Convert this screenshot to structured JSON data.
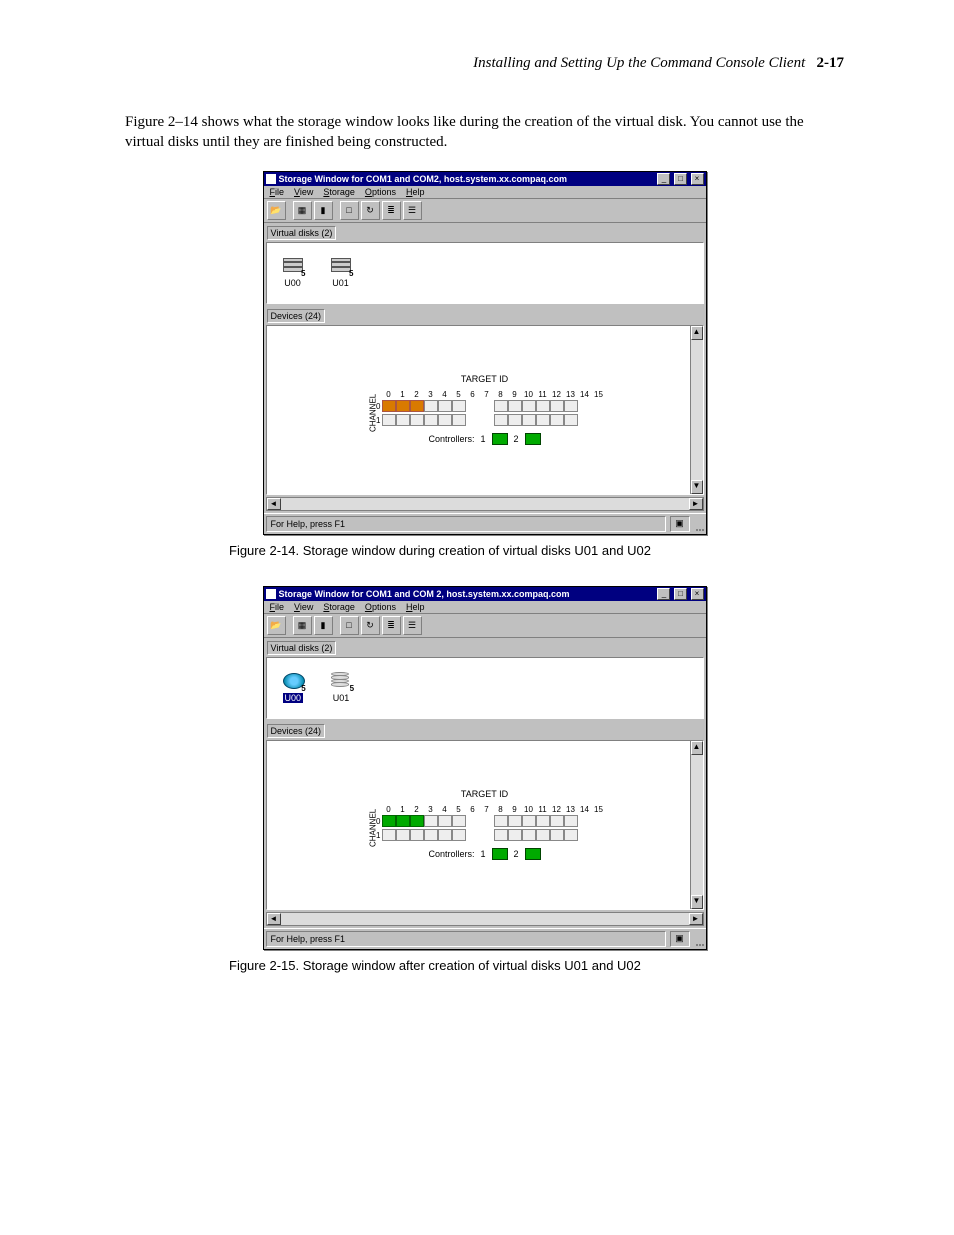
{
  "page": {
    "header_title": "Installing and Setting Up the Command Console Client",
    "header_page": "2-17",
    "intro": "Figure 2–14 shows what the storage window looks like during the creation of the virtual disk. You cannot use the virtual disks until they are finished being constructed."
  },
  "fig14": {
    "window_title": "Storage Window for COM1 and COM2, host.system.xx.compaq.com",
    "menus": {
      "file": "File",
      "view": "View",
      "storage": "Storage",
      "options": "Options",
      "help": "Help"
    },
    "vdisk_panel_label": "Virtual disks (2)",
    "vdisks": [
      {
        "name": "U00",
        "sub": "5",
        "state": "creating"
      },
      {
        "name": "U01",
        "sub": "5",
        "state": "creating"
      }
    ],
    "device_panel_label": "Devices (24)",
    "target_id_label": "TARGET ID",
    "channel_label": "CHANNEL",
    "target_ids": [
      "0",
      "1",
      "2",
      "3",
      "4",
      "5",
      "6",
      "7",
      "8",
      "9",
      "10",
      "11",
      "12",
      "13",
      "14",
      "15"
    ],
    "rows": [
      "0",
      "1"
    ],
    "row0_highlight_creating": [
      0,
      1,
      2
    ],
    "controllers_label": "Controllers:",
    "controllers": [
      "1",
      "2"
    ],
    "status": "For Help, press F1",
    "caption": "Figure 2-14.  Storage window during creation of virtual disks U01 and U02"
  },
  "fig15": {
    "window_title": "Storage Window for COM1 and COM 2, host.system.xx.compaq.com",
    "menus": {
      "file": "File",
      "view": "View",
      "storage": "Storage",
      "options": "Options",
      "help": "Help"
    },
    "vdisk_panel_label": "Virtual disks (2)",
    "vdisks": [
      {
        "name": "U00",
        "sub": "5",
        "state": "ready",
        "selected": true
      },
      {
        "name": "U01",
        "sub": "5",
        "state": "ready"
      }
    ],
    "device_panel_label": "Devices (24)",
    "target_id_label": "TARGET ID",
    "channel_label": "CHANNEL",
    "target_ids": [
      "0",
      "1",
      "2",
      "3",
      "4",
      "5",
      "6",
      "7",
      "8",
      "9",
      "10",
      "11",
      "12",
      "13",
      "14",
      "15"
    ],
    "rows": [
      "0",
      "1"
    ],
    "row0_highlight_ready": [
      0,
      1,
      2
    ],
    "controllers_label": "Controllers:",
    "controllers": [
      "1",
      "2"
    ],
    "status": "For Help, press F1",
    "caption": "Figure 2-15.  Storage window after creation of virtual disks U01 and U02"
  }
}
